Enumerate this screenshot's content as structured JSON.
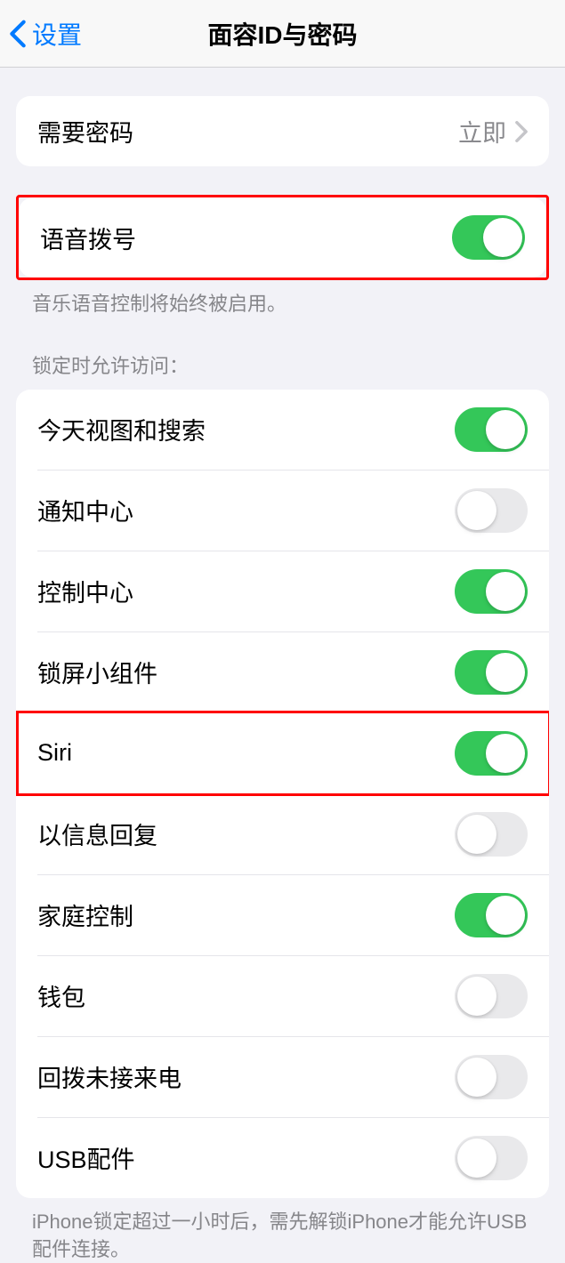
{
  "nav": {
    "back_label": "设置",
    "title": "面容ID与密码"
  },
  "require_passcode": {
    "label": "需要密码",
    "value": "立即"
  },
  "voice_dial": {
    "label": "语音拨号",
    "footer": "音乐语音控制将始终被启用。"
  },
  "lock_access": {
    "header": "锁定时允许访问：",
    "items": [
      {
        "label": "今天视图和搜索",
        "on": true,
        "highlight": false
      },
      {
        "label": "通知中心",
        "on": false,
        "highlight": false
      },
      {
        "label": "控制中心",
        "on": true,
        "highlight": false
      },
      {
        "label": "锁屏小组件",
        "on": true,
        "highlight": false
      },
      {
        "label": "Siri",
        "on": true,
        "highlight": true
      },
      {
        "label": "以信息回复",
        "on": false,
        "highlight": false
      },
      {
        "label": "家庭控制",
        "on": true,
        "highlight": false
      },
      {
        "label": "钱包",
        "on": false,
        "highlight": false
      },
      {
        "label": "回拨未接来电",
        "on": false,
        "highlight": false
      },
      {
        "label": "USB配件",
        "on": false,
        "highlight": false
      }
    ],
    "footer": "iPhone锁定超过一小时后，需先解锁iPhone才能允许USB配件连接。"
  }
}
